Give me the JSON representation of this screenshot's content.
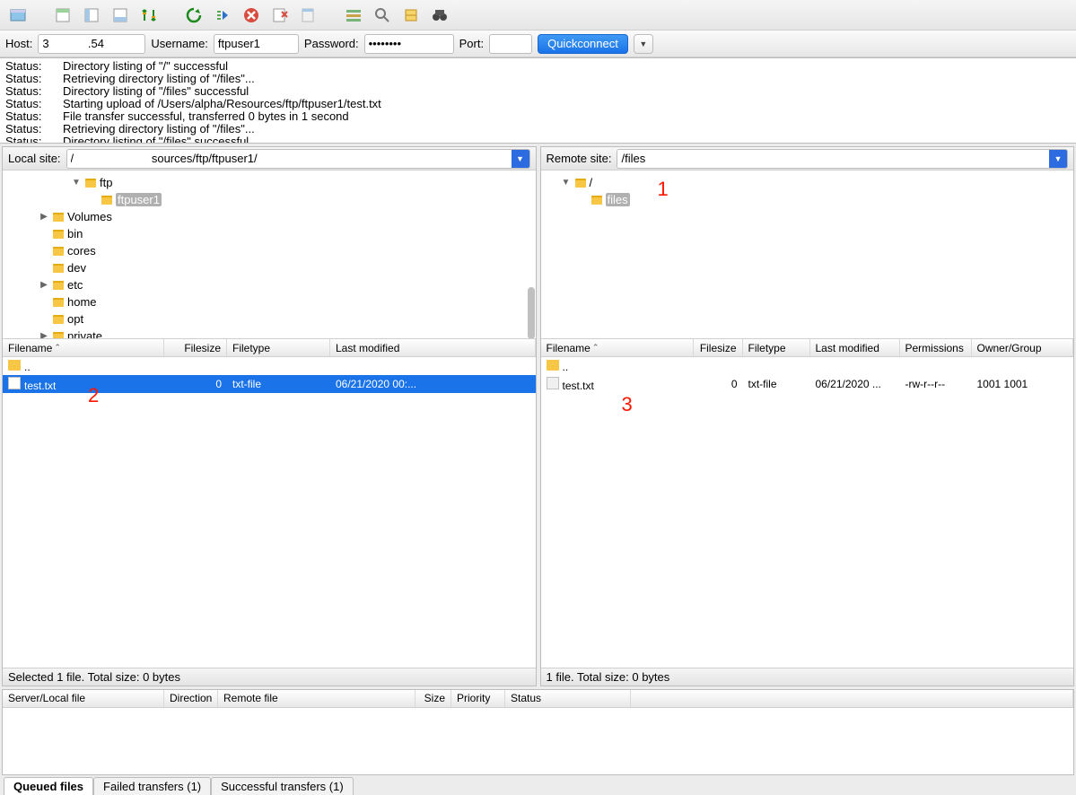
{
  "toolbar_icons": [
    "site-manager",
    "layout-1",
    "layout-2",
    "layout-3",
    "compare",
    "",
    "refresh",
    "process",
    "cancel",
    "disconnect",
    "clear",
    "",
    "filter",
    "search",
    "server",
    "binoculars"
  ],
  "connect": {
    "host_label": "Host:",
    "host_value": "3            .54",
    "user_label": "Username:",
    "user_value": "ftpuser1",
    "pass_label": "Password:",
    "pass_value": "••••••••",
    "port_label": "Port:",
    "port_value": "",
    "quick_label": "Quickconnect"
  },
  "log": [
    {
      "label": "Status:",
      "msg": "Directory listing of \"/\" successful"
    },
    {
      "label": "Status:",
      "msg": "Retrieving directory listing of \"/files\"..."
    },
    {
      "label": "Status:",
      "msg": "Directory listing of \"/files\" successful"
    },
    {
      "label": "Status:",
      "msg": "Starting upload of /Users/alpha/Resources/ftp/ftpuser1/test.txt"
    },
    {
      "label": "Status:",
      "msg": "File transfer successful, transferred 0 bytes in 1 second"
    },
    {
      "label": "Status:",
      "msg": "Retrieving directory listing of \"/files\"..."
    },
    {
      "label": "Status:",
      "msg": "Directory listing of \"/files\" successful"
    }
  ],
  "local": {
    "site_label": "Local site:",
    "site_value": "/                        sources/ftp/ftpuser1/",
    "tree": [
      {
        "indent": 3,
        "disclosure": "▼",
        "name": "ftp"
      },
      {
        "indent": 4,
        "disclosure": "",
        "name": "ftpuser1",
        "selected": true
      },
      {
        "indent": 1,
        "disclosure": "▶",
        "name": "Volumes"
      },
      {
        "indent": 1,
        "disclosure": "",
        "name": "bin"
      },
      {
        "indent": 1,
        "disclosure": "",
        "name": "cores"
      },
      {
        "indent": 1,
        "disclosure": "",
        "name": "dev"
      },
      {
        "indent": 1,
        "disclosure": "▶",
        "name": "etc"
      },
      {
        "indent": 1,
        "disclosure": "",
        "name": "home"
      },
      {
        "indent": 1,
        "disclosure": "",
        "name": "opt"
      },
      {
        "indent": 1,
        "disclosure": "▶",
        "name": "private"
      }
    ],
    "headers": {
      "filename": "Filename",
      "filesize": "Filesize",
      "filetype": "Filetype",
      "modified": "Last modified"
    },
    "files": [
      {
        "type": "up",
        "name": ".."
      },
      {
        "type": "file",
        "name": "test.txt",
        "size": "0",
        "ftype": "txt-file",
        "modified": "06/21/2020 00:...",
        "selected": true
      }
    ],
    "status": "Selected 1 file. Total size: 0 bytes"
  },
  "remote": {
    "site_label": "Remote site:",
    "site_value": "/files",
    "tree": [
      {
        "indent": 0,
        "disclosure": "▼",
        "name": "/"
      },
      {
        "indent": 1,
        "disclosure": "",
        "name": "files",
        "selected": true
      }
    ],
    "headers": {
      "filename": "Filename",
      "filesize": "Filesize",
      "filetype": "Filetype",
      "modified": "Last modified",
      "perms": "Permissions",
      "owner": "Owner/Group"
    },
    "files": [
      {
        "type": "up",
        "name": ".."
      },
      {
        "type": "file",
        "name": "test.txt",
        "size": "0",
        "ftype": "txt-file",
        "modified": "06/21/2020 ...",
        "perms": "-rw-r--r--",
        "owner": "1001 1001"
      }
    ],
    "status": "1 file. Total size: 0 bytes"
  },
  "annotations": {
    "a1": "1",
    "a2": "2",
    "a3": "3"
  },
  "queue_headers": {
    "server": "Server/Local file",
    "direction": "Direction",
    "remote": "Remote file",
    "size": "Size",
    "priority": "Priority",
    "status": "Status"
  },
  "bottom_tabs": {
    "queued": "Queued files",
    "failed": "Failed transfers (1)",
    "success": "Successful transfers (1)"
  }
}
